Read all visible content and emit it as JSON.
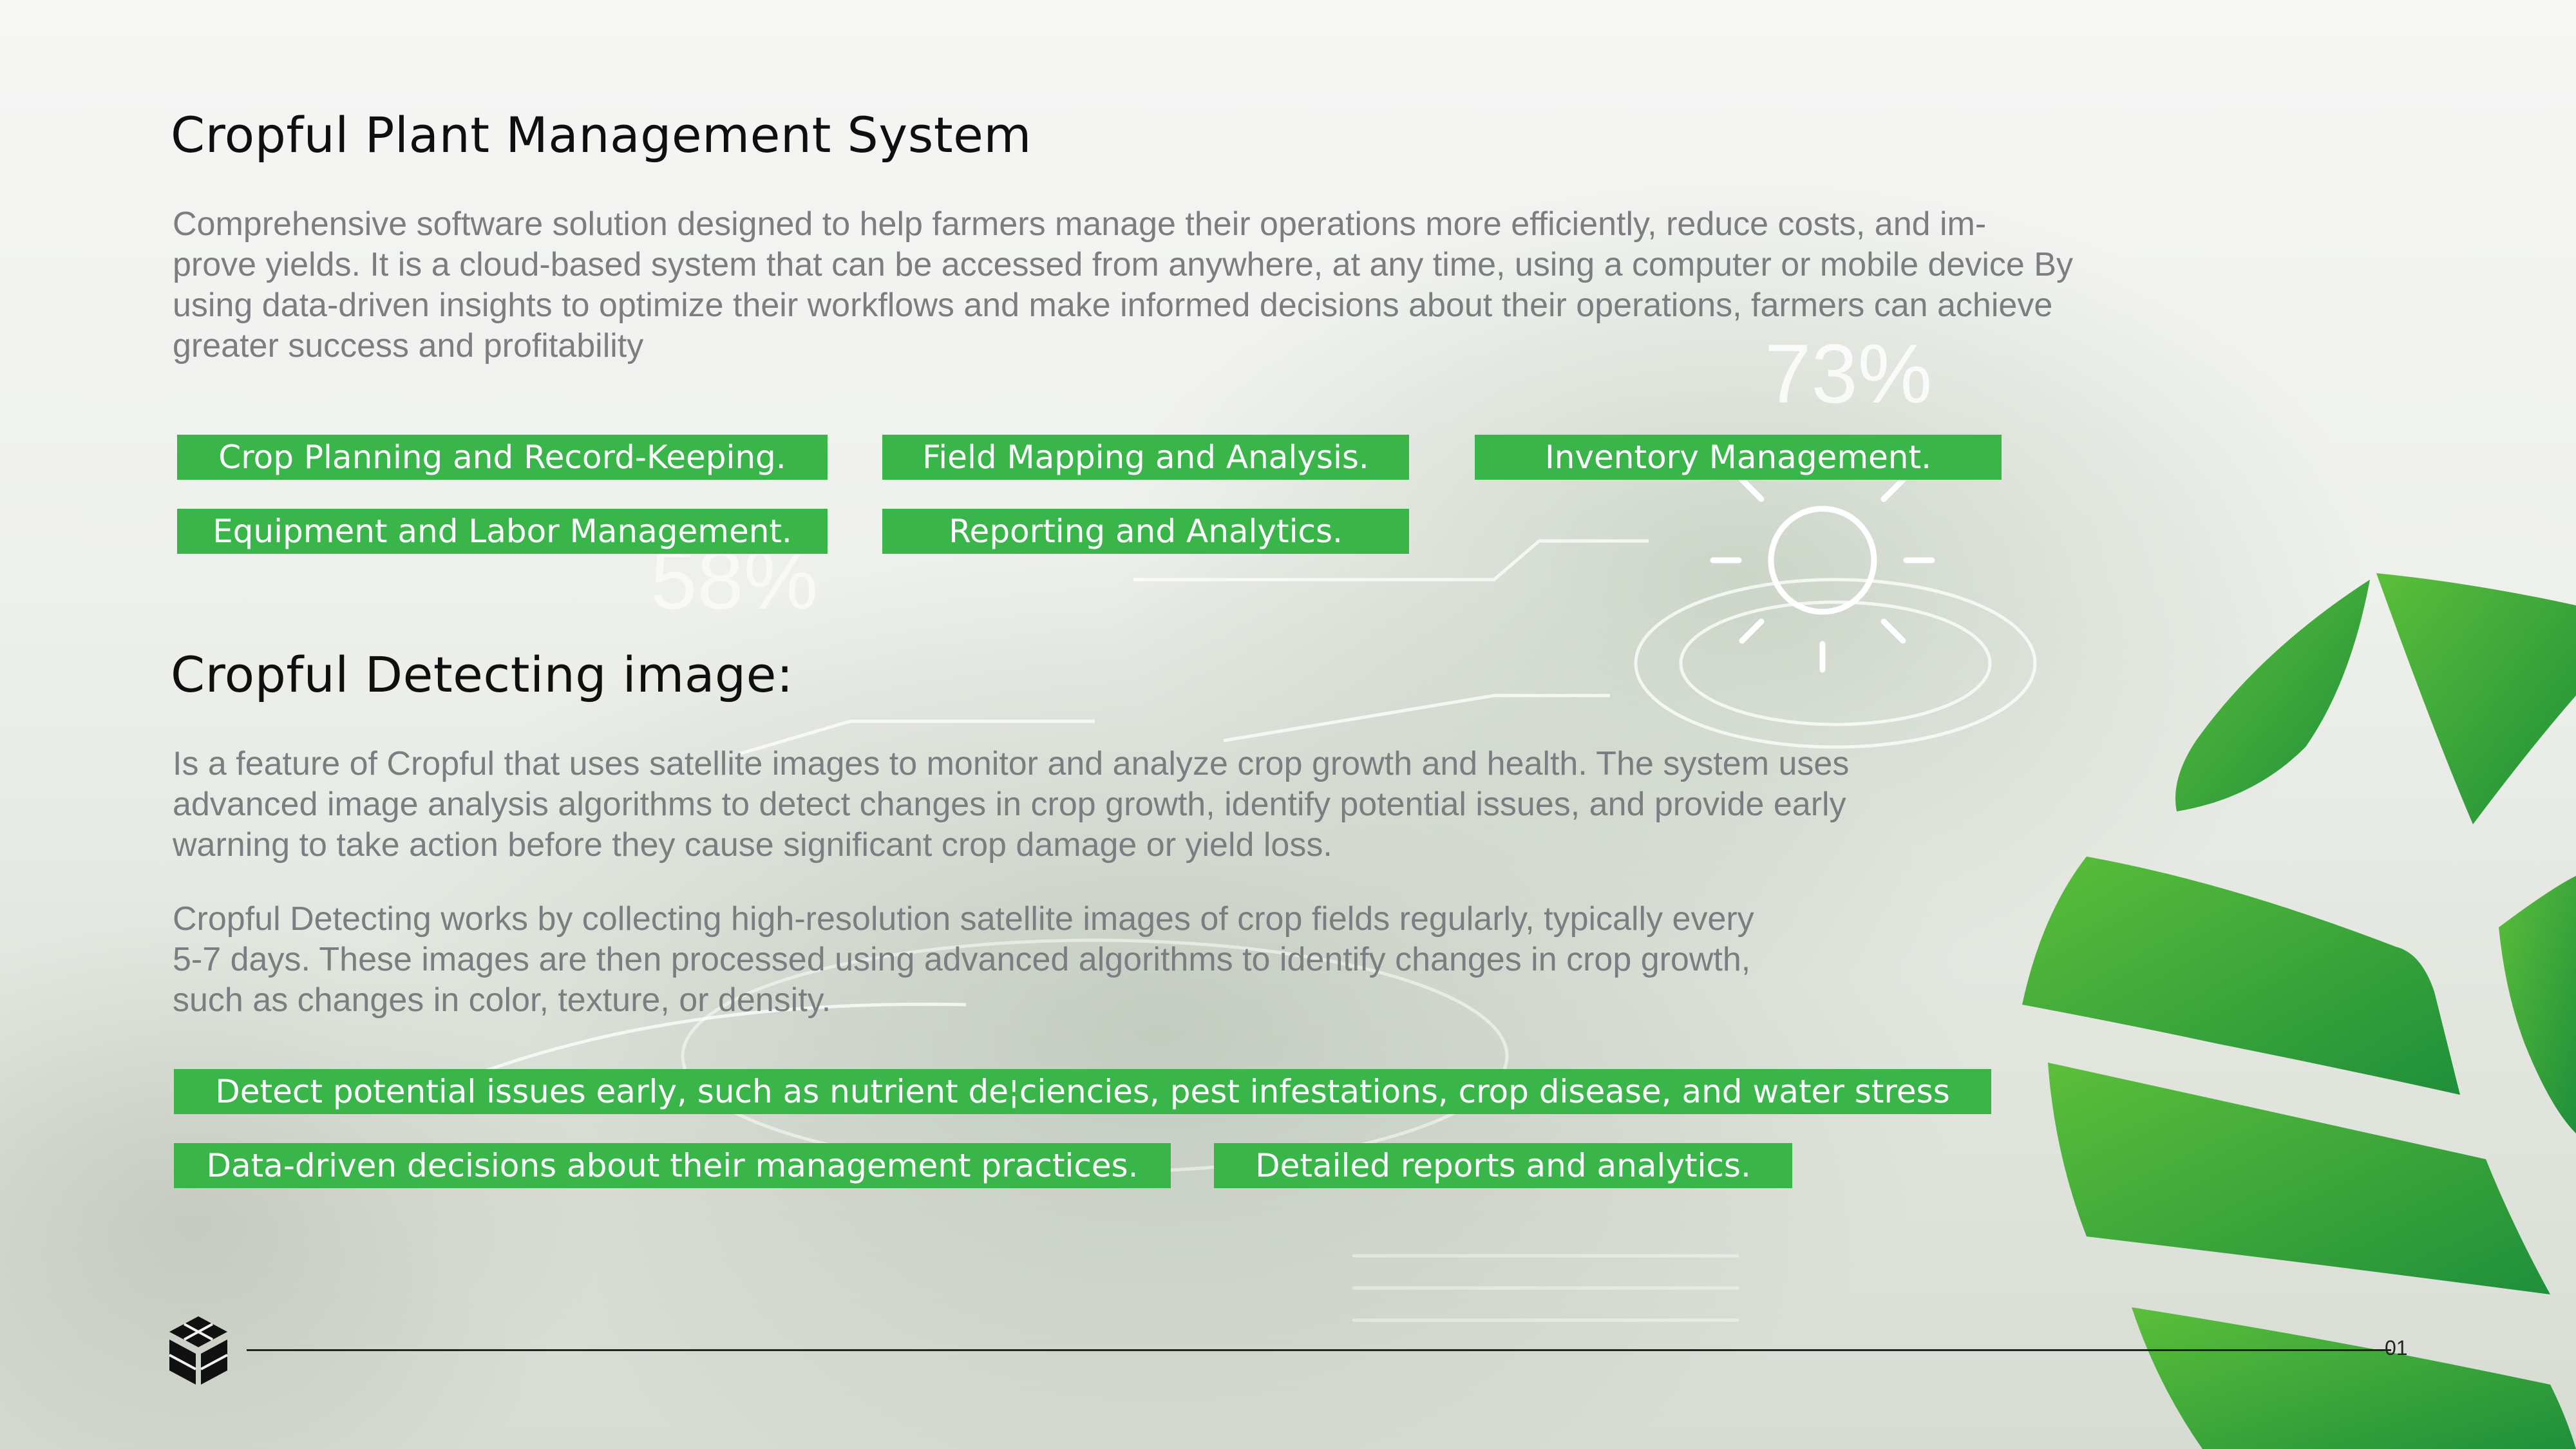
{
  "section1": {
    "title": "Cropful Plant Management System",
    "description_lines": [
      "Comprehensive software solution designed to help farmers manage their operations more efficiently, reduce costs, and im-",
      "prove yields. It is a cloud-based system that can be accessed from anywhere, at any time, using a computer or mobile device By",
      "using data-driven insights to optimize their workflows and make informed decisions about their operations, farmers can achieve",
      "greater success and profitability"
    ],
    "features": [
      "Crop Planning and Record-Keeping.",
      "Field Mapping and Analysis.",
      "Inventory Management.",
      "Equipment and Labor Management.",
      "Reporting and Analytics."
    ]
  },
  "section2": {
    "title": "Cropful Detecting image:",
    "paragraph1_lines": [
      "Is a feature of Cropful that uses satellite images to monitor and analyze crop growth and health. The system uses",
      "advanced image analysis algorithms to detect changes in crop growth, identify potential issues, and provide early",
      "warning to take action before they cause significant crop damage or yield loss."
    ],
    "paragraph2_lines": [
      "Cropful Detecting works by collecting high-resolution satellite images of crop fields regularly, typically every",
      "5-7 days. These images are then processed using advanced algorithms to identify changes in crop growth,",
      "such as changes in color, texture, or density."
    ],
    "benefits": [
      "Detect potential issues early, such as nutrient de¦ciencies, pest infestations, crop disease, and water stress",
      "Data-driven decisions about their management practices.",
      "Detailed reports and analytics."
    ]
  },
  "background_overlay": {
    "stat_1": "73%",
    "stat_2": "58%"
  },
  "footer": {
    "page_number": "01"
  },
  "colors": {
    "accent_green": "#39b54a",
    "leaf_green": "#2e9e3f",
    "title_text": "#0f0f0f",
    "body_text": "#7b7d80"
  },
  "icons": [
    "cropful-logo-icon",
    "leaf-graphic",
    "sun-icon"
  ]
}
